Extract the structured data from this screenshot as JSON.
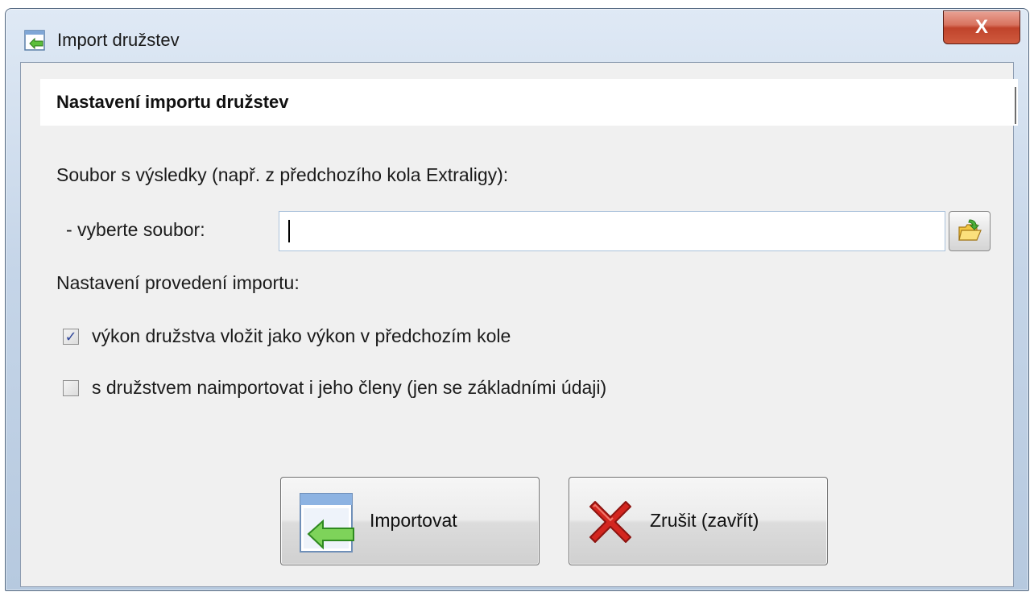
{
  "window": {
    "title": "Import družstev",
    "close_label": "X"
  },
  "header": {
    "title": "Nastavení importu družstev"
  },
  "form": {
    "source_label": "Soubor s výsledky (např. z předchozího kola Extraligy):",
    "file_label": "- vyberte soubor:",
    "file_value": "",
    "settings_label": "Nastavení provedení importu:",
    "options": [
      {
        "label": "výkon družstva vložit jako výkon v předchozím kole",
        "checked": true
      },
      {
        "label": "s družstvem naimportovat i jeho členy (jen se základními údaji)",
        "checked": false
      }
    ]
  },
  "buttons": {
    "import_label": "Importovat",
    "cancel_label": "Zrušit (zavřít)"
  },
  "colors": {
    "accent_green": "#4caf3a",
    "cancel_red": "#c8201b",
    "close_red": "#c0432b"
  },
  "icons": {
    "app": "import-window-icon",
    "browse": "open-folder-icon",
    "import": "import-arrow-icon",
    "cancel": "red-x-icon"
  }
}
